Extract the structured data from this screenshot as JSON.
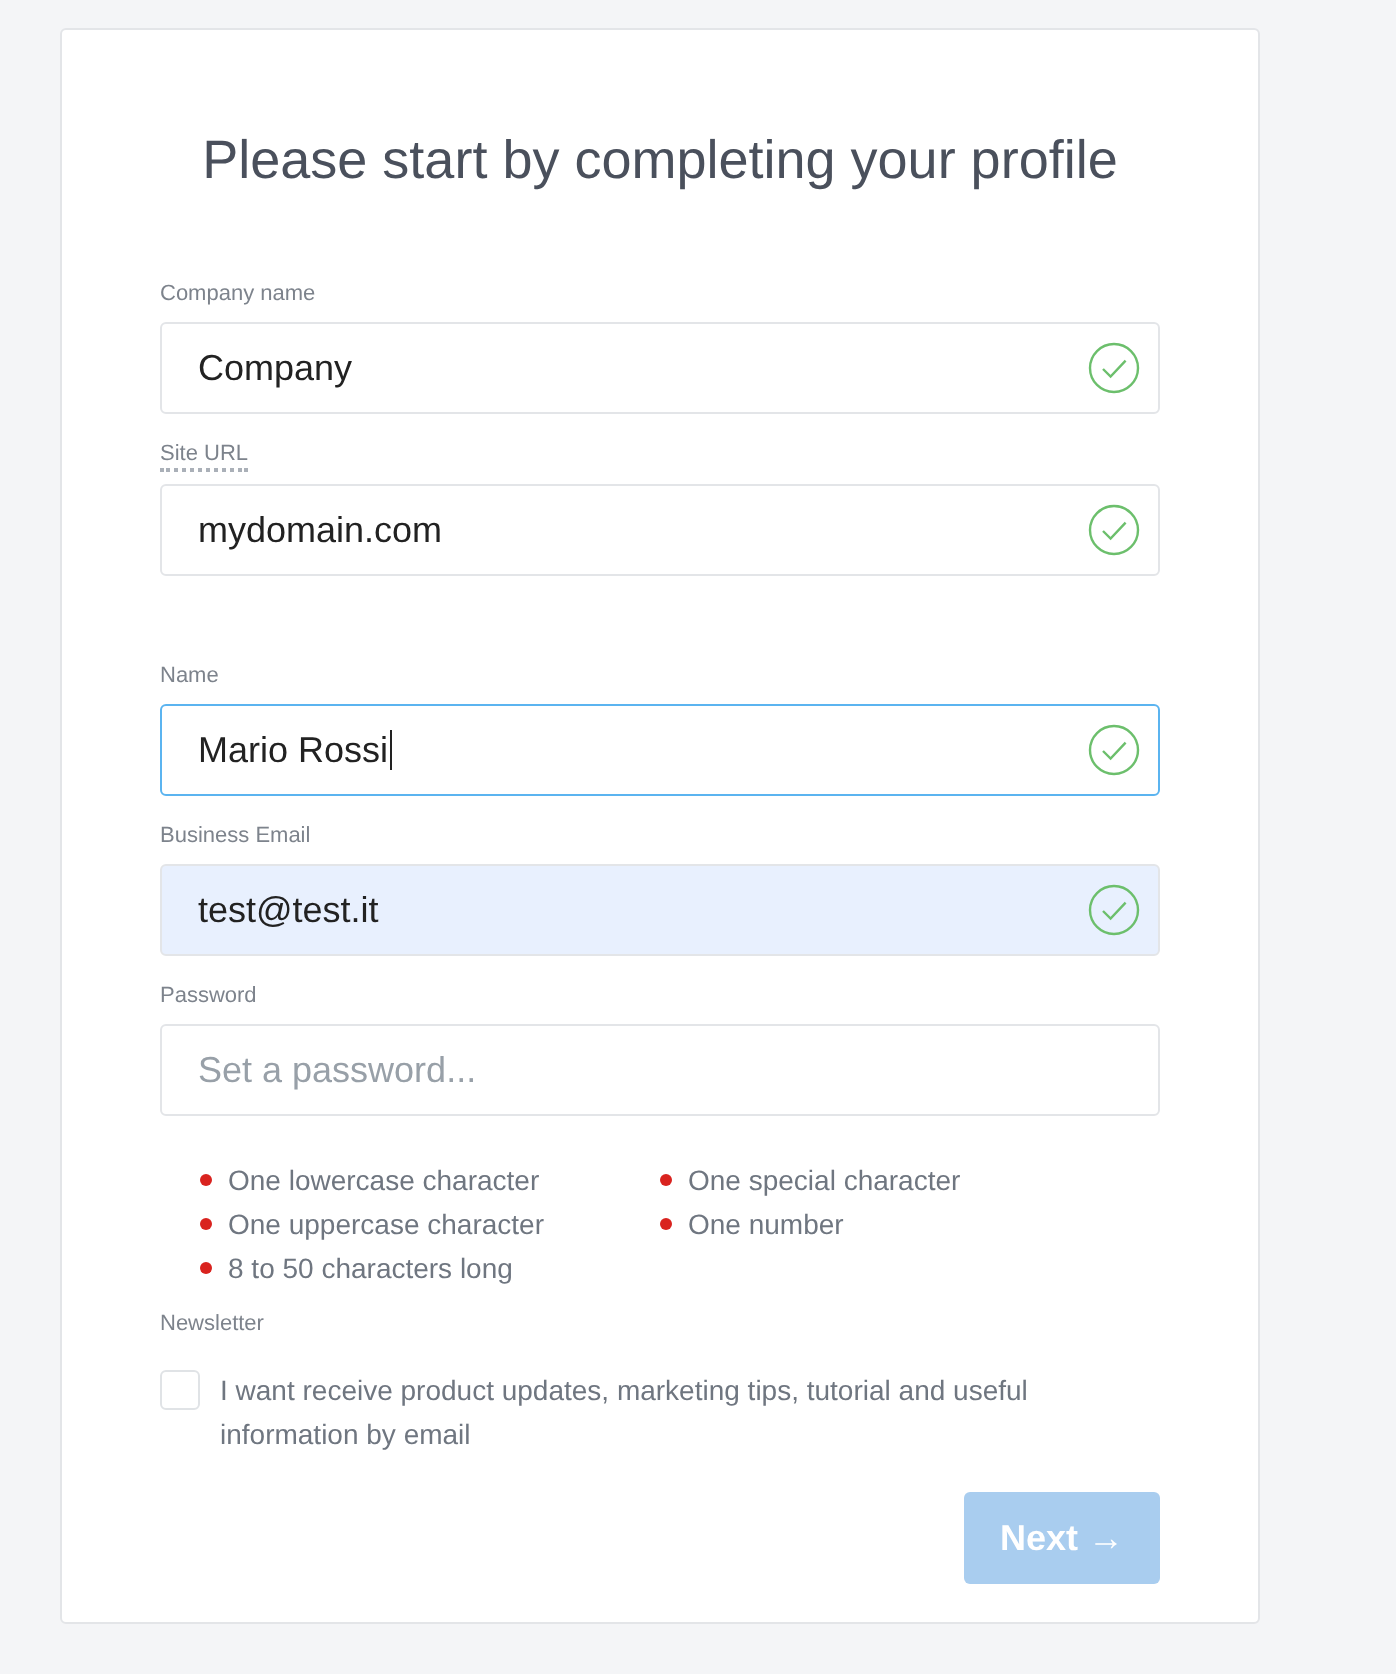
{
  "title": "Please start by completing your profile",
  "fields": [
    {
      "label": "Company name",
      "value": "Company",
      "valid": true,
      "focused": false,
      "autofilled": false,
      "label_hint": false,
      "gap_before": false
    },
    {
      "label": "Site URL",
      "value": "mydomain.com",
      "valid": true,
      "focused": false,
      "autofilled": false,
      "label_hint": true,
      "gap_before": false
    },
    {
      "label": "Name",
      "value": "Mario Rossi",
      "valid": true,
      "focused": true,
      "autofilled": false,
      "label_hint": false,
      "gap_before": true
    },
    {
      "label": "Business Email",
      "value": "test@test.it",
      "valid": true,
      "focused": false,
      "autofilled": true,
      "label_hint": false,
      "gap_before": false
    },
    {
      "label": "Password",
      "placeholder": "Set a password...",
      "valid": false,
      "focused": false,
      "autofilled": false,
      "label_hint": false,
      "gap_before": false
    }
  ],
  "password_rules": [
    {
      "text": "One lowercase character",
      "met": false
    },
    {
      "text": "One special character",
      "met": false
    },
    {
      "text": "One uppercase character",
      "met": false
    },
    {
      "text": "One number",
      "met": false
    },
    {
      "text": "8 to 50 characters long",
      "met": false
    }
  ],
  "newsletter": {
    "label": "Newsletter",
    "text": "I want receive product updates, marketing tips, tutorial and useful information by email",
    "checked": false
  },
  "next_button": {
    "label": "Next →",
    "disabled": true
  }
}
